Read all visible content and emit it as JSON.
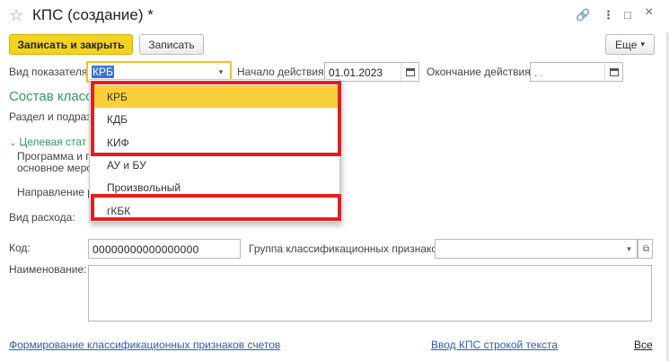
{
  "window": {
    "title": "КПС (создание) *",
    "controls": {
      "link": "🔗",
      "more": "⋮",
      "minimize": "□",
      "close": "×"
    }
  },
  "toolbar": {
    "save_close_label": "Записать и закрыть",
    "save_label": "Записать",
    "more_label": "Еще",
    "more_arrow": "▾"
  },
  "form": {
    "indicator_type_label": "Вид показателя:",
    "indicator_type_value": "КРБ",
    "start_label": "Начало действия:",
    "start_value": "01.01.2023",
    "end_label": "Окончание действия:",
    "end_value": " .  .",
    "section_title": "Состав класси",
    "section_label": "Раздел и подразд",
    "target_group": "Целевая стат",
    "program_label_1": "Программа и по",
    "program_label_2": "основное меропр",
    "direction_label": "Направление ра",
    "expense_label": "Вид расхода:",
    "code_label": "Код:",
    "code_value": "00000000000000000",
    "group_label": "Группа классификационных признаков:",
    "group_value": "",
    "name_label": "Наименование:",
    "name_value": ""
  },
  "dropdown": {
    "options": [
      "КРБ",
      "КДБ",
      "КИФ",
      "АУ и БУ",
      "Произвольный",
      "гКБК"
    ],
    "selected": "КРБ"
  },
  "footer": {
    "left_link": "Формирование классификационных признаков счетов",
    "mid_link": "Ввод КПС строкой текста",
    "right_link": "Все"
  },
  "colors": {
    "accent": "#f5d21f",
    "highlight": "#e02020",
    "green": "#2e9e5a",
    "link": "#2a5db0"
  }
}
